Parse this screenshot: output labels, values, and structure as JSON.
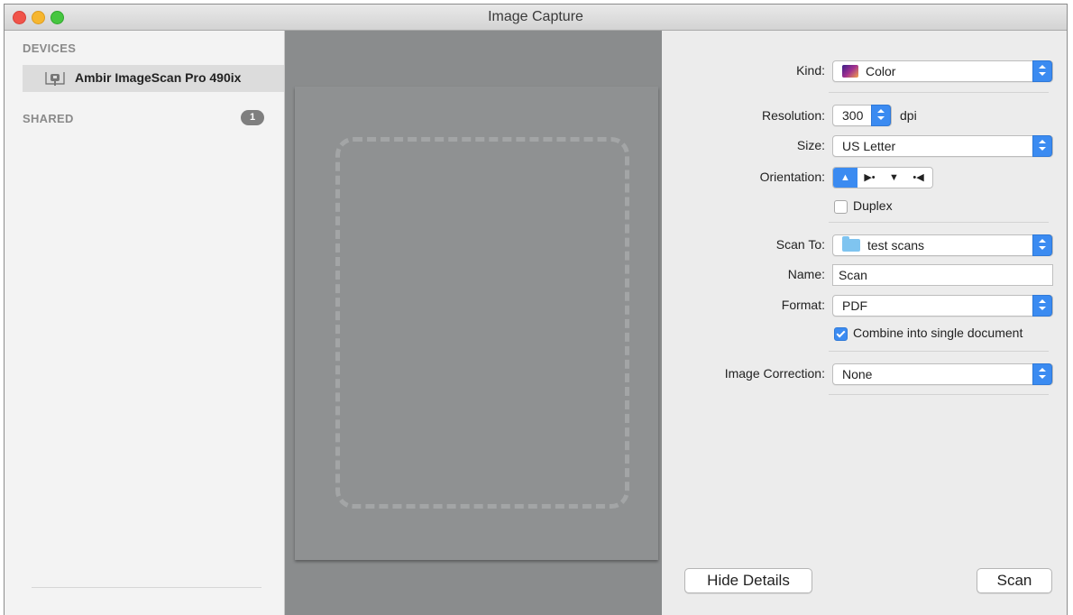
{
  "window": {
    "title": "Image Capture"
  },
  "sidebar": {
    "devices_header": "DEVICES",
    "device_name": "Ambir ImageScan Pro 490ix",
    "shared_header": "SHARED",
    "shared_count": "1"
  },
  "details": {
    "kind": {
      "label": "Kind:",
      "value": "Color"
    },
    "resolution": {
      "label": "Resolution:",
      "value": "300",
      "unit": "dpi"
    },
    "size": {
      "label": "Size:",
      "value": "US Letter"
    },
    "orientation": {
      "label": "Orientation:",
      "options": [
        "portrait-upright",
        "rotate-right",
        "upside-down",
        "rotate-left"
      ],
      "selected": "portrait-upright"
    },
    "duplex": {
      "label": "Duplex",
      "checked": false
    },
    "scan_to": {
      "label": "Scan To:",
      "value": "test scans"
    },
    "name": {
      "label": "Name:",
      "value": "Scan"
    },
    "format": {
      "label": "Format:",
      "value": "PDF"
    },
    "combine": {
      "label": "Combine into single document",
      "checked": true
    },
    "image_correction": {
      "label": "Image Correction:",
      "value": "None"
    }
  },
  "buttons": {
    "hide_details": "Hide Details",
    "scan": "Scan"
  },
  "colors": {
    "accent": "#3b8bf1",
    "preview_bg": "#8a8c8d",
    "folder": "#7fc4f0"
  }
}
